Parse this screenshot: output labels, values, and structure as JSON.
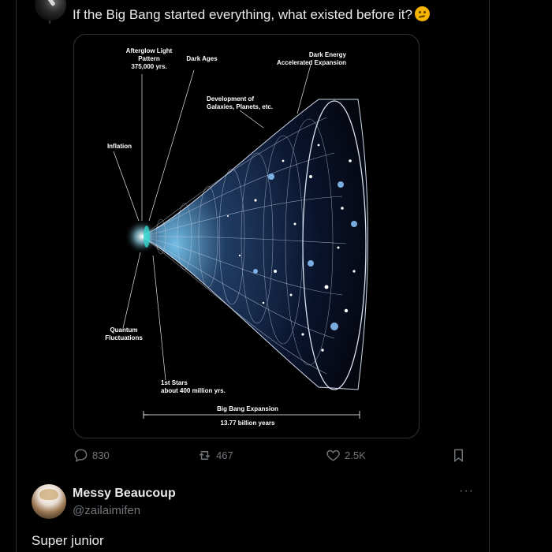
{
  "tweet": {
    "text": "If the Big Bang started everything, what existed before it?",
    "emoji": "thinking-face"
  },
  "image": {
    "labels": {
      "afterglow": "Afterglow Light\nPattern\n375,000 yrs.",
      "dark_ages": "Dark Ages",
      "dark_energy": "Dark Energy\nAccelerated Expansion",
      "galaxies": "Development of\nGalaxies, Planets, etc.",
      "inflation": "Inflation",
      "quantum": "Quantum\nFluctuations",
      "first_stars": "1st Stars\nabout 400 million yrs.",
      "expansion": "Big Bang Expansion",
      "years": "13.77 billion years"
    }
  },
  "actions": {
    "replies": "830",
    "retweets": "467",
    "likes": "2.5K"
  },
  "reply": {
    "name": "Messy Beaucoup",
    "handle": "@zailaimifen",
    "more": "···",
    "text": "Super junior"
  },
  "colors": {
    "background": "#000000",
    "text": "#e7e9ea",
    "muted": "#71767b",
    "border": "#2f3336"
  }
}
